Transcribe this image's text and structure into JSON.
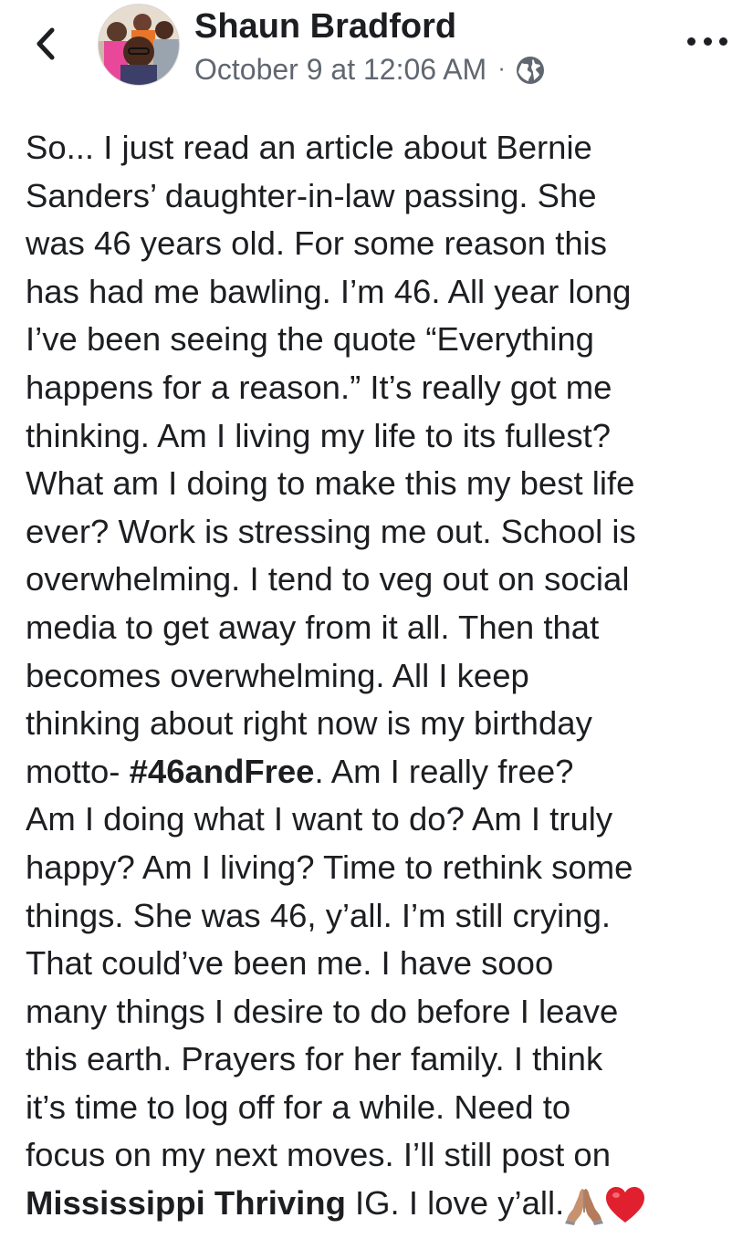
{
  "post": {
    "author": "Shaun Bradford",
    "timestamp": "October 9 at 12:06 AM",
    "separator": "·",
    "privacy_icon": "globe-icon",
    "lines": [
      {
        "text": "So... I just read an article about Bernie"
      },
      {
        "text": "Sanders’ daughter-in-law passing. She"
      },
      {
        "text": "was 46 years old. For some reason this"
      },
      {
        "text": "has had me bawling. I’m 46. All year long"
      },
      {
        "text": "I’ve been seeing the quote “Everything"
      },
      {
        "text": "happens for a reason.” It’s really got me"
      },
      {
        "text": "thinking. Am I living my life to its fullest?"
      },
      {
        "text": "What am I doing to make this my best life"
      },
      {
        "text": "ever? Work is stressing me out. School is"
      },
      {
        "text": "overwhelming. I tend to veg out on social"
      },
      {
        "text": "media to get away from it all. Then that"
      },
      {
        "text": "becomes overwhelming. All I keep"
      },
      {
        "text": "thinking about right now is my birthday"
      },
      {
        "pre": "motto- ",
        "hashtag": "#46andFree",
        "post": ". Am I really free?"
      },
      {
        "text": "Am I doing what I want to do? Am I truly"
      },
      {
        "text": "happy? Am I living? Time to rethink some"
      },
      {
        "text": "things. She was 46, y’all. I’m still crying."
      },
      {
        "text": "That could’ve been me. I have sooo"
      },
      {
        "text": "many things I desire to do before I leave"
      },
      {
        "text": "this earth. Prayers for her family. I think"
      },
      {
        "text": "it’s time to log off for a while. Need to"
      },
      {
        "text": "focus on my next moves. I’ll still post on"
      },
      {
        "mention": "Mississippi Thriving",
        "post": " IG. I love y’all."
      }
    ]
  },
  "icons": {
    "back": "chevron-left-icon",
    "more": "more-options-icon",
    "emoji_1": "praying-hands-emoji",
    "emoji_2": "red-heart-emoji"
  },
  "colors": {
    "text": "#1c1e21",
    "meta": "#606770",
    "heart": "#e0202e",
    "hands": "#c69270"
  }
}
